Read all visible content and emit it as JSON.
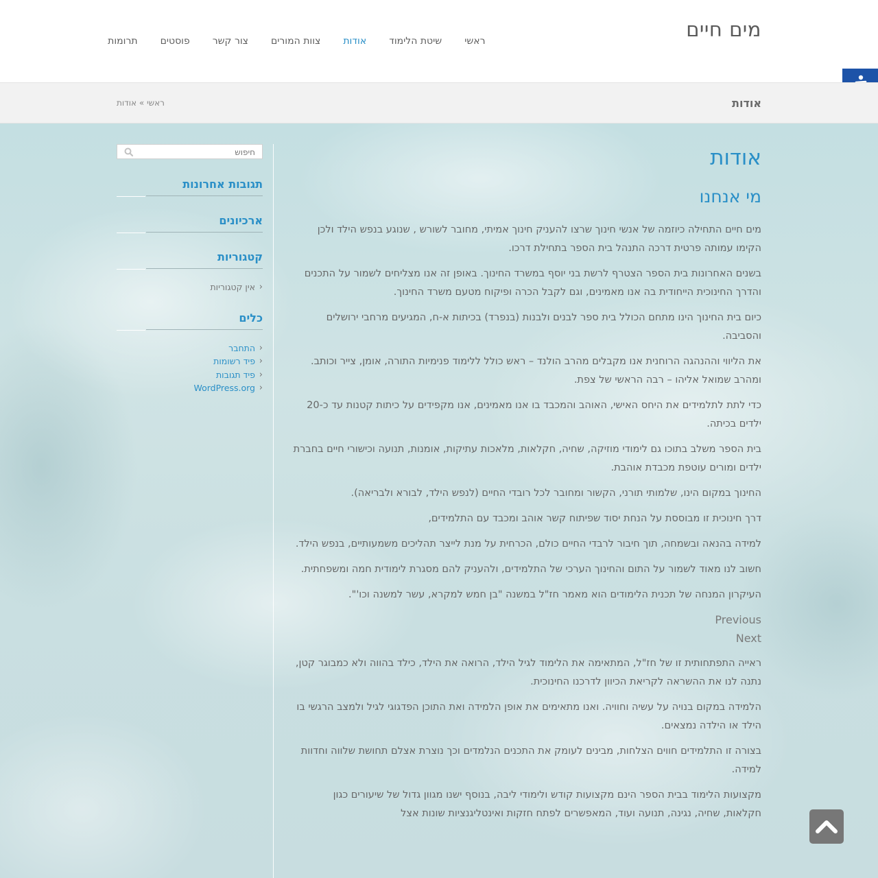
{
  "site": {
    "title": "מים חיים"
  },
  "nav": {
    "items": [
      {
        "label": "ראשי",
        "active": false
      },
      {
        "label": "שיטת הלימוד",
        "active": false
      },
      {
        "label": "אודות",
        "active": true
      },
      {
        "label": "צוות המורים",
        "active": false
      },
      {
        "label": "צור קשר",
        "active": false
      },
      {
        "label": "פוסטים",
        "active": false
      },
      {
        "label": "תרומות",
        "active": false
      }
    ]
  },
  "accessibility": {
    "icon": "accessibility-icon",
    "color": "#1d53a8"
  },
  "page_bar": {
    "title": "אודות",
    "breadcrumb": "ראשי » אודות"
  },
  "article": {
    "title": "אודות",
    "subtitle": "מי אנחנו",
    "paragraphs": [
      "מים חיים התחילה כיוזמה של אנשי חינוך שרצו להעניק חינוך אמיתי, מחובר לשורש , שנוגע בנפש הילד ולכן הקימו עמותה פרטית דרכה התנהל בית הספר בתחילת דרכו.",
      "בשנים האחרונות בית הספר הצטרף לרשת בני יוסף במשרד החינוך. באופן זה אנו מצליחים לשמור על התכנים והדרך החינוכית הייחודית בה אנו מאמינים, וגם לקבל הכרה ופיקוח מטעם משרד החינוך.",
      "כיום בית החינוך הינו מתחם הכולל בית ספר לבנים ולבנות (בנפרד) בכיתות א-ח, המגיעים מרחבי ירושלים והסביבה.",
      "את הליווי וההנהגה הרוחנית אנו מקבלים מהרב הולנד – ראש כולל ללימוד פנימיות התורה, אומן, צייר וכותב.",
      "ומהרב שמואל אליהו – רבה הראשי של צפת.",
      "כדי לתת לתלמידים את היחס האישי, האוהב והמכבד בו אנו מאמינים, אנו מקפידים על כיתות קטנות עד כ-20 ילדים בכיתה.",
      "בית הספר משלב בתוכו גם לימודי מוזיקה, שחיה, חקלאות, מלאכות עתיקות, אומנות, תנועה וכישורי חיים בחברת ילדים ומורים עוטפת מכבדת אוהבת.",
      "החינוך במקום הינו, שלמותי תורני, הקשור ומחובר לכל רובדי החיים (לנפש הילד, לבורא ולבריאה).",
      "דרך חינוכית זו מבוססת על הנחת יסוד שפיתוח קשר אוהב ומכבד עם התלמידים,",
      "למידה  בהנאה ובשמחה, תוך חיבור לרבדי החיים כולם, הכרחית על מנת לייצר תהליכים משמעותיים, בנפש הילד.",
      "חשוב לנו מאוד לשמור על התום והחינוך הערכי של התלמידים, ולהעניק להם מסגרת לימודית חמה ומשפחתית.",
      "העיקרון המנחה של תכנית הלימודים הוא מאמר חז\"ל במשנה \"בן חמש למקרא, עשר למשנה וכו'\"."
    ],
    "slider": {
      "previous": "Previous",
      "next": "Next"
    },
    "paragraphs2": [
      "ראייה התפתחותית זו של חז\"ל, המתאימה את הלימוד לגיל הילד, הרואה את הילד, כילד בהווה ולא כמבוגר קטן, נתנה לנו את ההשראה לקריאת הכיוון לדרכנו החינוכית.",
      "הלמידה במקום בנויה על עשיה וחוויה. ואנו מתאימים את אופן הלמידה ואת התוכן הפדגוגי לגיל ולמצב הרגשי בו הילד או הילדה נמצאים.",
      "בצורה זו התלמידים חווים הצלחות, מבינים לעומק את התכנים הנלמדים וכך נוצרת אצלם תחושת שלווה וחדוות למידה.",
      "מקצועות הלימוד בבית הספר הינם מקצועות קודש ולימודי ליבה, בנוסף ישנו מגוון גדול של שיעורים  כגון חקלאות, שחיה, נגינה, תנועה ועוד, המאפשרים לפתח חזקות ואינטליגנציות שונות אצל"
    ]
  },
  "sidebar": {
    "search": {
      "placeholder": "חיפוש"
    },
    "widgets": {
      "recent_comments": {
        "title": "תגובות אחרונות"
      },
      "archives": {
        "title": "ארכיונים"
      },
      "categories": {
        "title": "קטגוריות",
        "items": [
          "אין קטגוריות"
        ]
      },
      "meta": {
        "title": "כלים",
        "items": [
          "התחבר",
          "פיד רשומות",
          "פיד תגובות",
          "WordPress.org"
        ]
      }
    }
  },
  "scroll_top": {
    "icon": "chevron-up-icon",
    "color": "#777777"
  },
  "colors": {
    "accent": "#2a8fc7",
    "text": "#666666",
    "header_bg": "#ffffff",
    "bar_bg": "#f2f2f2"
  }
}
